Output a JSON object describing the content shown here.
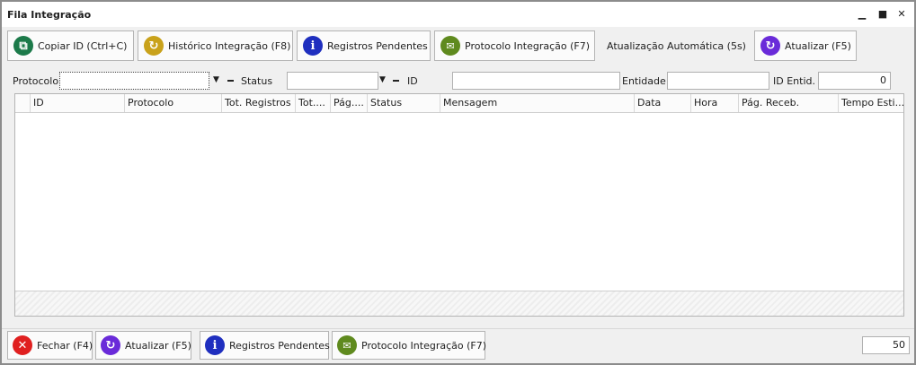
{
  "window": {
    "title": "Fila Integração",
    "controls": [
      "minimize",
      "restore",
      "close"
    ]
  },
  "toolbar": {
    "copy_id": {
      "label": "Copiar ID (Ctrl+C)",
      "icon": "copy-icon",
      "color": "#1c7a4a"
    },
    "historico": {
      "label": "Histórico Integração (F8)",
      "icon": "history-icon",
      "color": "#c9a21b"
    },
    "registros": {
      "label": "Registros Pendentes",
      "icon": "info-icon",
      "color": "#1f2fbf"
    },
    "protocolo": {
      "label": "Protocolo Integração (F7)",
      "icon": "chat-icon",
      "color": "#5f8a1e"
    },
    "auto_refresh": {
      "label": "Atualização Automática (5s)"
    },
    "atualizar": {
      "label": "Atualizar (F5)",
      "icon": "refresh-icon",
      "color": "#6a2bd9"
    }
  },
  "filters": {
    "protocolo": {
      "label": "Protocolo",
      "value": ""
    },
    "status": {
      "label": "Status",
      "value": ""
    },
    "id": {
      "label": "ID",
      "value": ""
    },
    "entidade": {
      "label": "Entidade",
      "value": ""
    },
    "id_entid": {
      "label": "ID Entid.",
      "value": "0"
    }
  },
  "grid": {
    "columns": [
      "ID",
      "Protocolo",
      "Tot. Registros",
      "Tot....",
      "Pág....",
      "Status",
      "Mensagem",
      "Data",
      "Hora",
      "Pág. Receb.",
      "Tempo Esti..."
    ],
    "rows": []
  },
  "bottombar": {
    "fechar": {
      "label": "Fechar (F4)",
      "icon": "close-circle-icon",
      "color": "#e02020"
    },
    "atualizar": {
      "label": "Atualizar (F5)",
      "icon": "refresh-icon",
      "color": "#6a2bd9"
    },
    "registros": {
      "label": "Registros Pendentes",
      "icon": "info-icon",
      "color": "#1f2fbf"
    },
    "protocolo": {
      "label": "Protocolo Integração (F7)",
      "icon": "chat-icon",
      "color": "#5f8a1e"
    },
    "page_size": "50"
  }
}
